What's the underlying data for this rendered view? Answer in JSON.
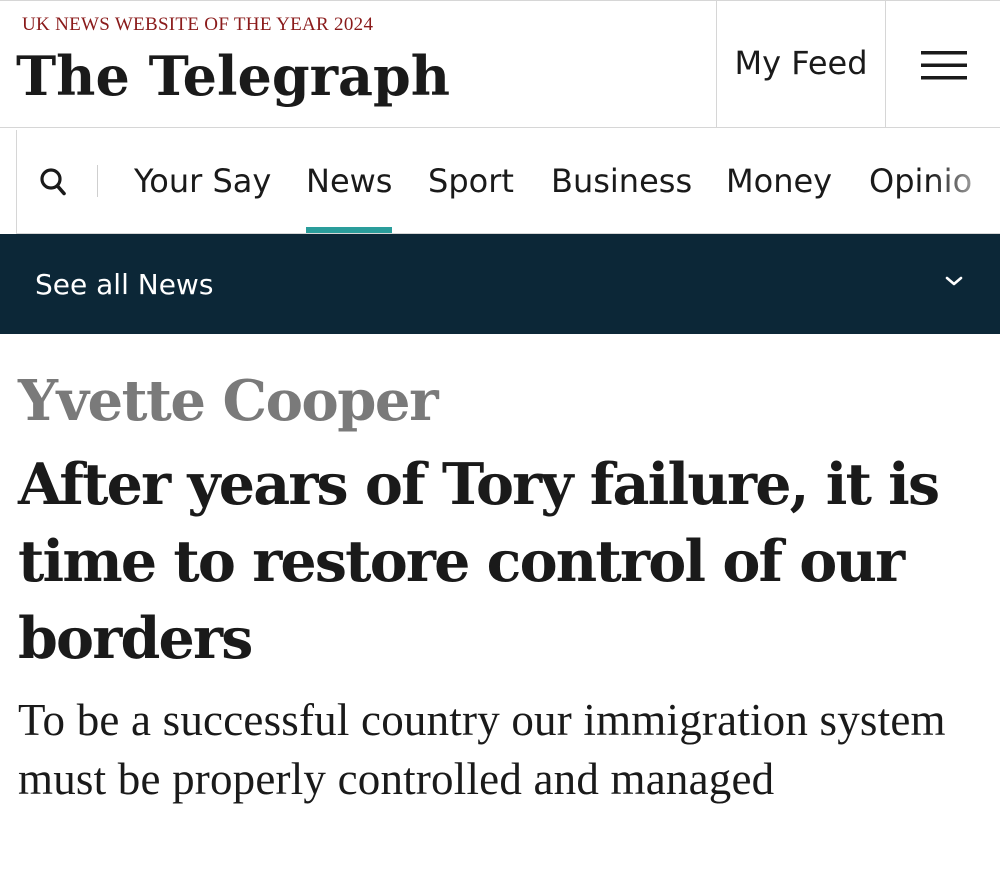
{
  "masthead": {
    "award": "UK NEWS WEBSITE OF THE YEAR 2024",
    "logo_text": "The Telegraph",
    "my_feed_label": "My Feed",
    "menu_icon": "hamburger-menu-icon"
  },
  "nav": {
    "search_icon": "search-icon",
    "items": [
      {
        "label": "Your Say"
      },
      {
        "label": "News",
        "active": true
      },
      {
        "label": "Sport"
      },
      {
        "label": "Business"
      },
      {
        "label": "Money"
      },
      {
        "label": "Opinio"
      }
    ],
    "active_color": "#2a9d9b"
  },
  "section_bar": {
    "label": "See all News",
    "chevron_icon": "chevron-down-icon",
    "background": "#0c2737"
  },
  "article": {
    "byline": "Yvette Cooper",
    "headline": "After years of Tory failure, it is time to restore control of our borders",
    "standfirst": "To be a successful country our immigration system must be properly controlled and managed"
  },
  "colors": {
    "award_red": "#8a1a1a",
    "byline_grey": "#7a7a7a",
    "text": "#1a1a1a"
  }
}
